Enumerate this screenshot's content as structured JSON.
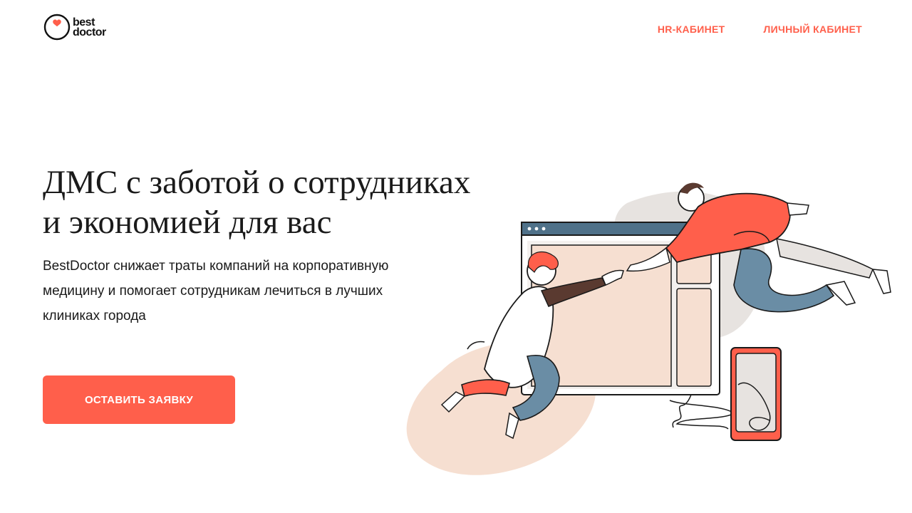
{
  "header": {
    "logo": {
      "line1": "best",
      "line2": "doctor"
    },
    "nav": {
      "hr_cabinet": "HR-КАБИНЕТ",
      "personal_cabinet": "ЛИЧНЫЙ КАБИНЕТ"
    }
  },
  "hero": {
    "title_line1": "ДМС с заботой о сотрудниках",
    "title_line2": "и экономией для вас",
    "description_line1": "BestDoctor снижает траты компаний на корпоративную",
    "description_line2": "медицину и помогает сотрудникам лечиться в лучших",
    "description_line3": "клиниках города",
    "cta_label": "ОСТАВИТЬ ЗАЯВКУ"
  },
  "colors": {
    "accent": "#ff5f4b",
    "text": "#1a1a1a",
    "peach": "#f6dfd1",
    "grey_blob": "#e7e3e0",
    "browser_bar": "#4f7189",
    "pants_blue": "#6a8da5",
    "sweater_brown": "#5a3a30"
  },
  "icons": {
    "logo": "heart-in-circle-icon"
  }
}
